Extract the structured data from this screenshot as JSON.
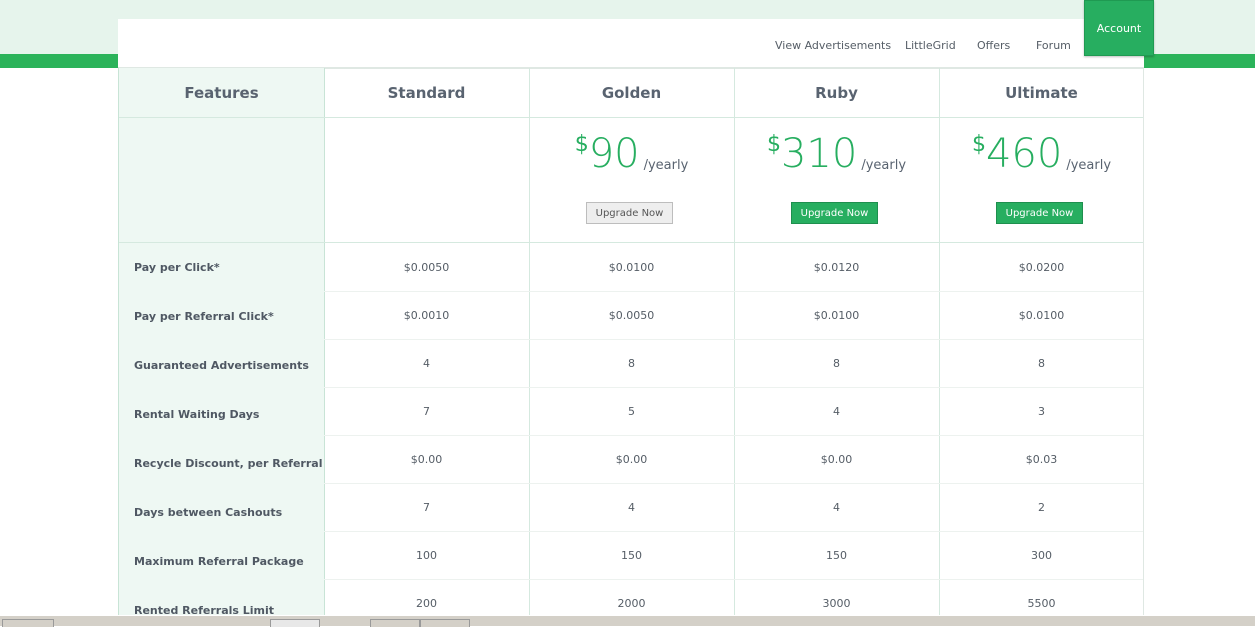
{
  "nav": {
    "links": [
      "View Advertisements",
      "LittleGrid",
      "Offers",
      "Forum"
    ],
    "account_label": "Account"
  },
  "table": {
    "headers": [
      "Features",
      "Standard",
      "Golden",
      "Ruby",
      "Ultimate"
    ],
    "prices": [
      {
        "currency": "$",
        "amount": "90",
        "period": "/yearly",
        "button": "Upgrade Now",
        "button_style": "gray"
      },
      {
        "currency": "$",
        "amount": "310",
        "period": "/yearly",
        "button": "Upgrade Now",
        "button_style": "green"
      },
      {
        "currency": "$",
        "amount": "460",
        "period": "/yearly",
        "button": "Upgrade Now",
        "button_style": "green"
      }
    ],
    "rows": [
      {
        "label": "Pay per Click*",
        "values": [
          "$0.0050",
          "$0.0100",
          "$0.0120",
          "$0.0200"
        ]
      },
      {
        "label": "Pay per Referral Click*",
        "values": [
          "$0.0010",
          "$0.0050",
          "$0.0100",
          "$0.0100"
        ]
      },
      {
        "label": "Guaranteed Advertisements",
        "values": [
          "4",
          "8",
          "8",
          "8"
        ]
      },
      {
        "label": "Rental Waiting Days",
        "values": [
          "7",
          "5",
          "4",
          "3"
        ]
      },
      {
        "label": "Recycle Discount, per Referral",
        "values": [
          "$0.00",
          "$0.00",
          "$0.00",
          "$0.03"
        ]
      },
      {
        "label": "Days between Cashouts",
        "values": [
          "7",
          "4",
          "4",
          "2"
        ]
      },
      {
        "label": "Maximum Referral Package",
        "values": [
          "100",
          "150",
          "150",
          "300"
        ]
      },
      {
        "label": "Rented Referrals Limit",
        "values": [
          "200",
          "2000",
          "3000",
          "5500"
        ]
      }
    ]
  },
  "colors": {
    "accent": "#27ae60",
    "features_bg": "#eef8f3",
    "header_bg": "#e6f4ec"
  }
}
